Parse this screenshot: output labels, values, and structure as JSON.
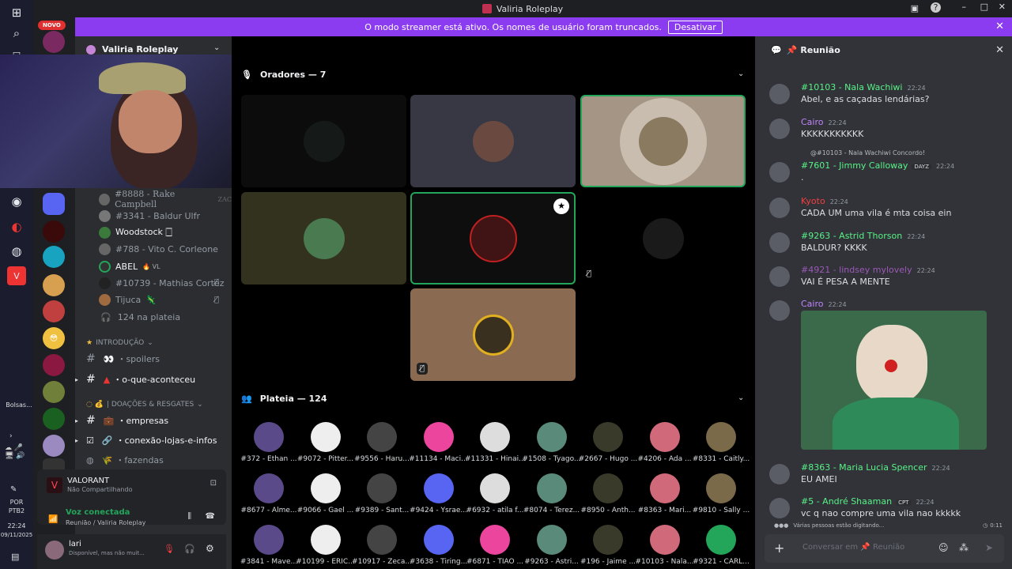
{
  "window": {
    "title": "Valiria Roleplay"
  },
  "banner": {
    "text": "O modo streamer está ativo. Os nomes de usuário foram truncados.",
    "button": "Desativar"
  },
  "taskbar": {
    "bolsas": "Bolsas...",
    "lang": "POR",
    "lang2": "PTB2",
    "time": "22:24",
    "date": "09/11/2025"
  },
  "guild": {
    "new_badge": "NOVO",
    "name": "Valiria Roleplay"
  },
  "sidebar": {
    "voice_members": [
      "#8888 - Rake Campbell",
      "#3341 - Baldur Ulfr",
      "Woodstock 🀆",
      "#788 - Vito C. Corleone",
      "ABEL",
      "#10739 - Mathias Cortez",
      "Tijuca"
    ],
    "audience_count": "124 na plateia",
    "channels": [
      {
        "name": "INTRODUÇÃO",
        "category": true
      },
      {
        "name": "spoilers"
      },
      {
        "name": "o-que-aconteceu"
      },
      {
        "name": "| DOAÇÕES & RESGATES",
        "category": true
      },
      {
        "name": "empresas"
      },
      {
        "name": "conexão-lojas-e-infos"
      },
      {
        "name": "fazendas"
      }
    ]
  },
  "activity": {
    "game": "VALORANT",
    "status": "Não Compartilhando"
  },
  "voice_status": {
    "title": "Voz conectada",
    "channel": "Reunião / Valiria Roleplay"
  },
  "user": {
    "name": "lari",
    "status": "Disponível, mas não muit..."
  },
  "stage": {
    "speakers_title": "Oradores — 7",
    "audience_title": "Plateia — 124",
    "audience": [
      "#372 - Ethan ...",
      "#9072 - Pitter...",
      "#9556 - Haru...",
      "#11134 - Maci...",
      "#11331 - Hinai...",
      "#1508 - Tyago...",
      "#2667 - Hugo ...",
      "#4206 - Ada ...",
      "#8331 - Caitly...",
      "#8677 - Alme...",
      "#9066 - Gael ...",
      "#9389 - Sant...",
      "#9424 - Ysrae...",
      "#6932 - atila f...",
      "#8074 - Terez...",
      "#8950 - Anth...",
      "#8363 - Mari...",
      "#9810 - Sally ...",
      "#3841 - Mave...",
      "#10199 - ERIC...",
      "#10917 - Zeca...",
      "#3638 - Tiring...",
      "#6871 - TIAO ...",
      "#9263 - Astri...",
      "#196 - Jaime ...",
      "#10103 - Nala...",
      "#9321 - CARL..."
    ]
  },
  "chat": {
    "title": "Reunião",
    "typing": "Várias pessoas estão digitando...",
    "slowmode": "0:11",
    "placeholder": "Conversar em 📌 Reunião",
    "messages": [
      {
        "name": "#10103 - Nala Wachiwi",
        "time": "22:24",
        "text": "Abel, e as caçadas lendárias?",
        "color": "#57f287"
      },
      {
        "name": "Cairo",
        "time": "22:24",
        "text": "KKKKKKKKKKK",
        "color": "#c084fc"
      },
      {
        "reply": "@#10103 - Nala Wachiwi Concordo!",
        "name": "#7601 - Jimmy Calloway",
        "tag": "DAYZ",
        "time": "22:24",
        "text": ".",
        "color": "#57f287"
      },
      {
        "name": "Kyoto",
        "time": "22:24",
        "text": "CADA UM uma vila é mta coisa ein",
        "color": "#f23f42"
      },
      {
        "name": "#9263 - Astrid Thorson",
        "time": "22:24",
        "text": "BALDUR? KKKK",
        "color": "#57f287"
      },
      {
        "name": "#4921 - lindsey mylovely",
        "time": "22:24",
        "text": "VAI É PESA A MENTE",
        "color": "#9b59b6"
      },
      {
        "name": "Cairo",
        "time": "22:24",
        "text": "",
        "color": "#c084fc"
      },
      {
        "name": "#8363 - Maria Lucia Spencer",
        "time": "22:24",
        "text": "EU AMEI",
        "color": "#57f287"
      },
      {
        "name": "#5 - André Shaaman",
        "tag": "CPT",
        "time": "22:24",
        "text": "vc q nao compre uma vila nao kkkkk",
        "color": "#57f287"
      }
    ]
  }
}
